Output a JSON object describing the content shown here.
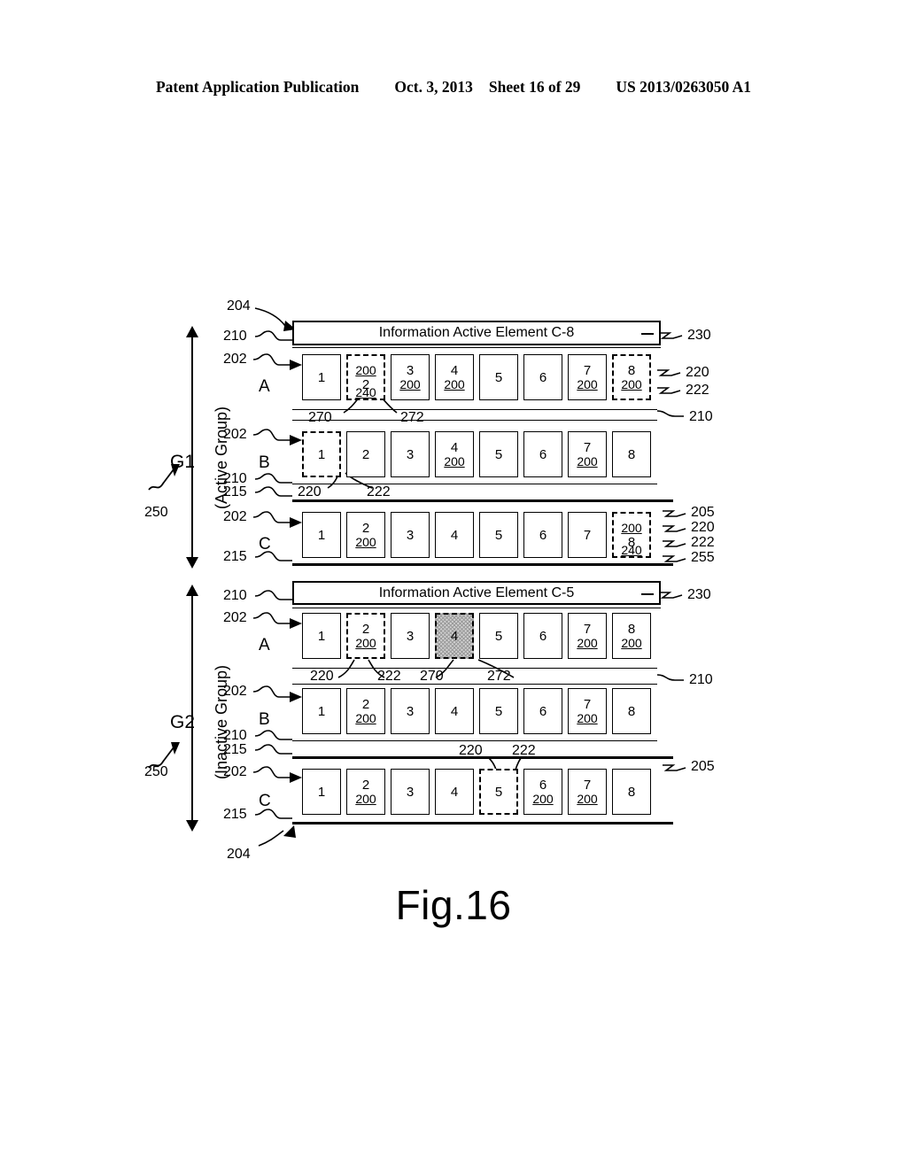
{
  "header": {
    "publication": "Patent Application Publication",
    "date": "Oct. 3, 2013",
    "sheet": "Sheet 16 of 29",
    "docnum": "US 2013/0263050 A1"
  },
  "figure": {
    "caption": "Fig.16",
    "top_callout": "204",
    "bottom_callout": "204"
  },
  "groups": [
    {
      "name": "G1",
      "axis_label": "(Active Group)",
      "axis_callout": "250",
      "info_bar": {
        "text": "Information Active Element C-8",
        "callout": "230",
        "left_callout": "210"
      },
      "rows": [
        {
          "letter": "A",
          "left_callouts": [
            "202"
          ],
          "cells": [
            {
              "num": "1",
              "sub": "",
              "sup": "",
              "dashed": false,
              "shaded": false,
              "below": ""
            },
            {
              "num": "2",
              "sub": "",
              "sup": "200",
              "dashed": true,
              "shaded": false,
              "below": "240"
            },
            {
              "num": "3",
              "sub": "200",
              "sup": "",
              "dashed": false,
              "shaded": false,
              "below": ""
            },
            {
              "num": "4",
              "sub": "200",
              "sup": "",
              "dashed": false,
              "shaded": false,
              "below": ""
            },
            {
              "num": "5",
              "sub": "",
              "sup": "",
              "dashed": false,
              "shaded": false,
              "below": ""
            },
            {
              "num": "6",
              "sub": "",
              "sup": "",
              "dashed": false,
              "shaded": false,
              "below": ""
            },
            {
              "num": "7",
              "sub": "200",
              "sup": "",
              "dashed": false,
              "shaded": false,
              "below": ""
            },
            {
              "num": "8",
              "sub": "200",
              "sup": "",
              "dashed": true,
              "shaded": false,
              "below": ""
            }
          ],
          "right_callouts": [
            "220",
            "222"
          ],
          "below_callouts": [
            "270",
            "272"
          ],
          "below_right_callout": "210"
        },
        {
          "letter": "B",
          "left_callouts": [
            "202",
            "210",
            "215"
          ],
          "cells": [
            {
              "num": "1",
              "sub": "",
              "sup": "",
              "dashed": true,
              "shaded": false,
              "below": ""
            },
            {
              "num": "2",
              "sub": "",
              "sup": "",
              "dashed": false,
              "shaded": false,
              "below": ""
            },
            {
              "num": "3",
              "sub": "",
              "sup": "",
              "dashed": false,
              "shaded": false,
              "below": ""
            },
            {
              "num": "4",
              "sub": "200",
              "sup": "",
              "dashed": false,
              "shaded": false,
              "below": ""
            },
            {
              "num": "5",
              "sub": "",
              "sup": "",
              "dashed": false,
              "shaded": false,
              "below": ""
            },
            {
              "num": "6",
              "sub": "",
              "sup": "",
              "dashed": false,
              "shaded": false,
              "below": ""
            },
            {
              "num": "7",
              "sub": "200",
              "sup": "",
              "dashed": false,
              "shaded": false,
              "below": ""
            },
            {
              "num": "8",
              "sub": "",
              "sup": "",
              "dashed": false,
              "shaded": false,
              "below": ""
            }
          ],
          "below_callouts": [
            "220",
            "222"
          ]
        },
        {
          "letter": "C",
          "left_callouts": [
            "202",
            "215"
          ],
          "cells": [
            {
              "num": "1",
              "sub": "",
              "sup": "",
              "dashed": false,
              "shaded": false,
              "below": ""
            },
            {
              "num": "2",
              "sub": "200",
              "sup": "",
              "dashed": false,
              "shaded": false,
              "below": ""
            },
            {
              "num": "3",
              "sub": "",
              "sup": "",
              "dashed": false,
              "shaded": false,
              "below": ""
            },
            {
              "num": "4",
              "sub": "",
              "sup": "",
              "dashed": false,
              "shaded": false,
              "below": ""
            },
            {
              "num": "5",
              "sub": "",
              "sup": "",
              "dashed": false,
              "shaded": false,
              "below": ""
            },
            {
              "num": "6",
              "sub": "",
              "sup": "",
              "dashed": false,
              "shaded": false,
              "below": ""
            },
            {
              "num": "7",
              "sub": "",
              "sup": "",
              "dashed": false,
              "shaded": false,
              "below": ""
            },
            {
              "num": "8",
              "sub": "",
              "sup": "200",
              "dashed": true,
              "shaded": false,
              "below": "240"
            }
          ],
          "right_callouts": [
            "205",
            "220",
            "222",
            "255"
          ]
        }
      ]
    },
    {
      "name": "G2",
      "axis_label": "(Inactive Group)",
      "axis_callout": "250",
      "info_bar": {
        "text": "Information Active Element C-5",
        "callout": "230",
        "left_callout": "210"
      },
      "rows": [
        {
          "letter": "A",
          "left_callouts": [
            "202"
          ],
          "cells": [
            {
              "num": "1",
              "sub": "",
              "sup": "",
              "dashed": false,
              "shaded": false,
              "below": ""
            },
            {
              "num": "2",
              "sub": "200",
              "sup": "",
              "dashed": true,
              "shaded": false,
              "below": ""
            },
            {
              "num": "3",
              "sub": "",
              "sup": "",
              "dashed": false,
              "shaded": false,
              "below": ""
            },
            {
              "num": "4",
              "sub": "",
              "sup": "",
              "dashed": true,
              "shaded": true,
              "below": ""
            },
            {
              "num": "5",
              "sub": "",
              "sup": "",
              "dashed": false,
              "shaded": false,
              "below": ""
            },
            {
              "num": "6",
              "sub": "",
              "sup": "",
              "dashed": false,
              "shaded": false,
              "below": ""
            },
            {
              "num": "7",
              "sub": "200",
              "sup": "",
              "dashed": false,
              "shaded": false,
              "below": ""
            },
            {
              "num": "8",
              "sub": "200",
              "sup": "",
              "dashed": false,
              "shaded": false,
              "below": ""
            }
          ],
          "below_callouts": [
            "220",
            "222",
            "270",
            "272"
          ],
          "below_right_callout": "210"
        },
        {
          "letter": "B",
          "left_callouts": [
            "202",
            "210",
            "215"
          ],
          "cells": [
            {
              "num": "1",
              "sub": "",
              "sup": "",
              "dashed": false,
              "shaded": false,
              "below": ""
            },
            {
              "num": "2",
              "sub": "200",
              "sup": "",
              "dashed": false,
              "shaded": false,
              "below": ""
            },
            {
              "num": "3",
              "sub": "",
              "sup": "",
              "dashed": false,
              "shaded": false,
              "below": ""
            },
            {
              "num": "4",
              "sub": "",
              "sup": "",
              "dashed": false,
              "shaded": false,
              "below": ""
            },
            {
              "num": "5",
              "sub": "",
              "sup": "",
              "dashed": false,
              "shaded": false,
              "below": ""
            },
            {
              "num": "6",
              "sub": "",
              "sup": "",
              "dashed": false,
              "shaded": false,
              "below": ""
            },
            {
              "num": "7",
              "sub": "200",
              "sup": "",
              "dashed": false,
              "shaded": false,
              "below": ""
            },
            {
              "num": "8",
              "sub": "",
              "sup": "",
              "dashed": false,
              "shaded": false,
              "below": ""
            }
          ],
          "below_callouts": [
            "220",
            "222"
          ]
        },
        {
          "letter": "C",
          "left_callouts": [
            "202",
            "215"
          ],
          "cells": [
            {
              "num": "1",
              "sub": "",
              "sup": "",
              "dashed": false,
              "shaded": false,
              "below": ""
            },
            {
              "num": "2",
              "sub": "200",
              "sup": "",
              "dashed": false,
              "shaded": false,
              "below": ""
            },
            {
              "num": "3",
              "sub": "",
              "sup": "",
              "dashed": false,
              "shaded": false,
              "below": ""
            },
            {
              "num": "4",
              "sub": "",
              "sup": "",
              "dashed": false,
              "shaded": false,
              "below": ""
            },
            {
              "num": "5",
              "sub": "",
              "sup": "",
              "dashed": true,
              "shaded": false,
              "below": ""
            },
            {
              "num": "6",
              "sub": "200",
              "sup": "",
              "dashed": false,
              "shaded": false,
              "below": ""
            },
            {
              "num": "7",
              "sub": "200",
              "sup": "",
              "dashed": false,
              "shaded": false,
              "below": ""
            },
            {
              "num": "8",
              "sub": "",
              "sup": "",
              "dashed": false,
              "shaded": false,
              "below": ""
            }
          ],
          "right_callout": "205"
        }
      ]
    }
  ]
}
